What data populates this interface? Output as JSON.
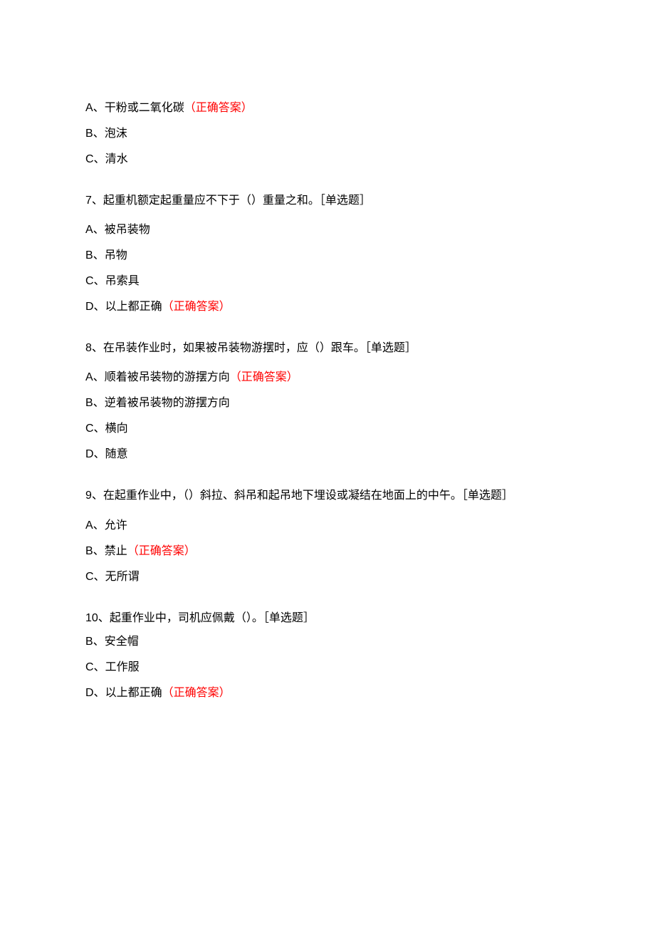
{
  "correct_label": "（正确答案）",
  "type_label": "［单选题］",
  "q6_options": {
    "a": {
      "letter": "A、",
      "text": "干粉或二氧化碳",
      "correct": true
    },
    "b": {
      "letter": "B、",
      "text": "泡沫",
      "correct": false
    },
    "c": {
      "letter": "C、",
      "text": "清水",
      "correct": false
    }
  },
  "q7": {
    "number": "7、",
    "text": "起重机额定起重量应不下于（）重量之和。",
    "options": {
      "a": {
        "letter": "A、",
        "text": "被吊装物",
        "correct": false
      },
      "b": {
        "letter": "B、",
        "text": "吊物",
        "correct": false
      },
      "c": {
        "letter": "C、",
        "text": "吊索具",
        "correct": false
      },
      "d": {
        "letter": "D、",
        "text": "以上都正确",
        "correct": true
      }
    }
  },
  "q8": {
    "number": "8、",
    "text": "在吊装作业时，如果被吊装物游摆时，应（）跟车。",
    "options": {
      "a": {
        "letter": "A、",
        "text": "顺着被吊装物的游摆方向",
        "correct": true
      },
      "b": {
        "letter": "B、",
        "text": "逆着被吊装物的游摆方向",
        "correct": false
      },
      "c": {
        "letter": "C、",
        "text": "横向",
        "correct": false
      },
      "d": {
        "letter": "D、",
        "text": "随意",
        "correct": false
      }
    }
  },
  "q9": {
    "number": "9、",
    "text": "在起重作业中，（）斜拉、斜吊和起吊地下埋设或凝结在地面上的中午。［单选题］",
    "options": {
      "a": {
        "letter": "A、",
        "text": "允许",
        "correct": false
      },
      "b": {
        "letter": "B、",
        "text": "禁止",
        "correct": true
      },
      "c": {
        "letter": "C、",
        "text": "无所谓",
        "correct": false
      }
    }
  },
  "q10": {
    "number": "10、",
    "text": "起重作业中，司机应佩戴（）。",
    "options": {
      "b": {
        "letter": "B、",
        "text": "安全帽",
        "correct": false
      },
      "c": {
        "letter": "C、",
        "text": "工作服",
        "correct": false
      },
      "d": {
        "letter": "D、",
        "text": "以上都正确",
        "correct": true
      }
    }
  }
}
